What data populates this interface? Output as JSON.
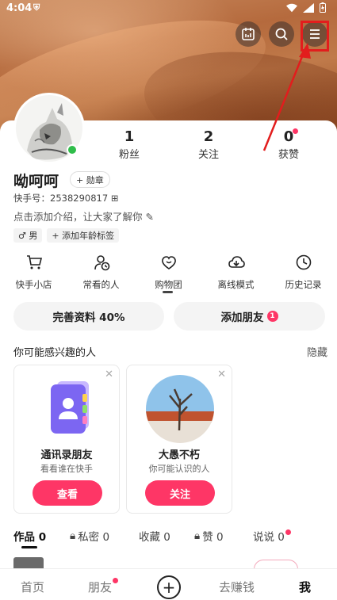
{
  "status_bar": {
    "time": "4:04"
  },
  "profile": {
    "name": "呦呵呵",
    "badge_label": "+ 勋章",
    "kuaishou_id": "快手号：2538290817 ⊞",
    "intro": "点击添加介绍，让大家了解你 ✎",
    "tags": [
      "♂ 男",
      "+ 添加年龄标签"
    ]
  },
  "stats": [
    {
      "num": "1",
      "label": "粉丝"
    },
    {
      "num": "2",
      "label": "关注"
    },
    {
      "num": "0",
      "label": "获赞"
    }
  ],
  "functions": [
    {
      "label": "快手小店",
      "icon": "cart-icon"
    },
    {
      "label": "常看的人",
      "icon": "person-clock-icon"
    },
    {
      "label": "购物团",
      "icon": "heart-bag-icon"
    },
    {
      "label": "离线模式",
      "icon": "cloud-download-icon"
    },
    {
      "label": "历史记录",
      "icon": "clock-icon"
    }
  ],
  "actions": {
    "complete_profile": "完善资料 40%",
    "add_friend": "添加朋友",
    "add_friend_count": "1"
  },
  "recommend": {
    "title": "你可能感兴趣的人",
    "hide": "隐藏",
    "cards": [
      {
        "name": "通讯录朋友",
        "sub": "看看谁在快手",
        "button": "查看"
      },
      {
        "name": "大愚不朽",
        "sub": "你可能认识的人",
        "button": "关注"
      }
    ]
  },
  "tabs": [
    {
      "label": "作品 0"
    },
    {
      "label": "私密 0"
    },
    {
      "label": "收藏 0"
    },
    {
      "label": "赞 0"
    },
    {
      "label": "说说 0"
    }
  ],
  "bottom_nav": [
    "首页",
    "朋友",
    "去赚钱",
    "我"
  ],
  "colors": {
    "accent": "#fe3666",
    "online": "#2fbd4a",
    "highlight": "#e21d1d"
  }
}
